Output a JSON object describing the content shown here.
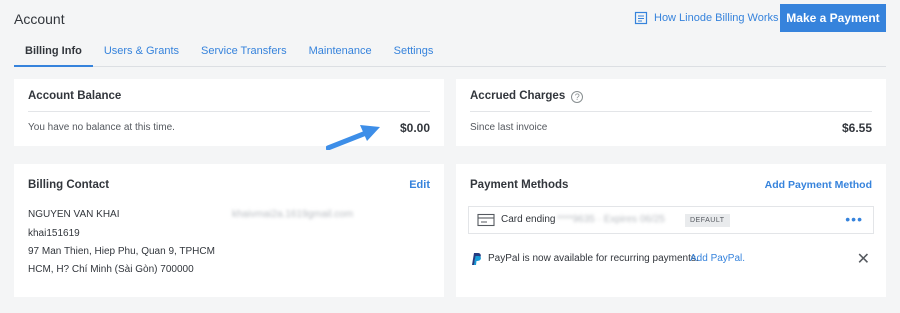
{
  "header": {
    "title": "Account",
    "help_link": "How Linode Billing Works",
    "pay_button": "Make a Payment"
  },
  "tabs": [
    {
      "label": "Billing Info",
      "active": true
    },
    {
      "label": "Users & Grants",
      "active": false
    },
    {
      "label": "Service Transfers",
      "active": false
    },
    {
      "label": "Maintenance",
      "active": false
    },
    {
      "label": "Settings",
      "active": false
    }
  ],
  "account_balance": {
    "title": "Account Balance",
    "message": "You have no balance at this time.",
    "amount": "$0.00"
  },
  "accrued_charges": {
    "title": "Accrued Charges",
    "help_icon": "question-circle-icon",
    "label": "Since last invoice",
    "amount": "$6.55"
  },
  "billing_contact": {
    "title": "Billing Contact",
    "edit_label": "Edit",
    "name": "NGUYEN VAN KHAI",
    "username": "khai151619",
    "email_redacted": "khaivmai2a.1619gmail.com",
    "address_line1": "97 Man Thien, Hiep Phu, Quan 9, TPHCM",
    "address_line2": "HCM, H? Chí Minh (Sài Gòn) 700000"
  },
  "payment_methods": {
    "title": "Payment Methods",
    "add_label": "Add Payment Method",
    "card_label": "Card ending",
    "card_redacted": "****9635 · Expires 06/25",
    "default_badge": "DEFAULT",
    "more_icon": "more-horizontal-icon",
    "paypal_text": "PayPal is now available for recurring payments.",
    "paypal_link": "Add PayPal."
  },
  "colors": {
    "accent": "#3683dc",
    "background": "#f4f5f6",
    "text": "#32363c"
  }
}
